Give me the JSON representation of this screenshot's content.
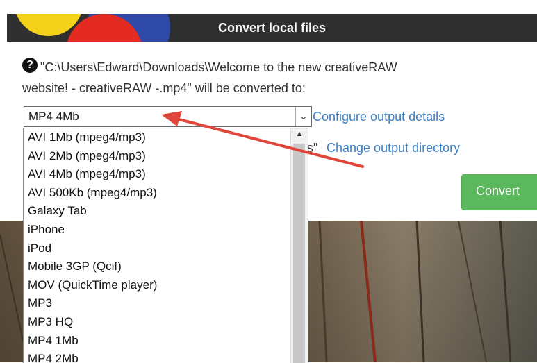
{
  "dialog": {
    "title": "Convert local files",
    "message_line1": "\"C:\\Users\\Edward\\Downloads\\Welcome to the new creativeRAW",
    "message_line2": "website! - creativeRAW -.mp4\" will be converted to:"
  },
  "format_select": {
    "selected": "MP4 4Mb",
    "options": [
      "AVI 1Mb (mpeg4/mp3)",
      "AVI 2Mb (mpeg4/mp3)",
      "AVI 4Mb (mpeg4/mp3)",
      "AVI 500Kb (mpeg4/mp3)",
      "Galaxy Tab",
      "iPhone",
      "iPod",
      "Mobile 3GP (Qcif)",
      "MOV (QuickTime player)",
      "MP3",
      "MP3 HQ",
      "MP4 1Mb",
      "MP4 2Mb"
    ]
  },
  "links": {
    "configure": "Configure output details",
    "directory_prefix": "s\"",
    "directory": "Change output directory"
  },
  "convert_button": "Convert",
  "colors": {
    "header_bg": "#2f2f2f",
    "link": "#3b7fc4",
    "convert_green": "#5cb85c",
    "arrow_red": "#e0453a"
  },
  "icons": {
    "help": "question-circle-icon",
    "dropdown": "chevron-down-icon",
    "scroll_up": "triangle-up-icon"
  }
}
